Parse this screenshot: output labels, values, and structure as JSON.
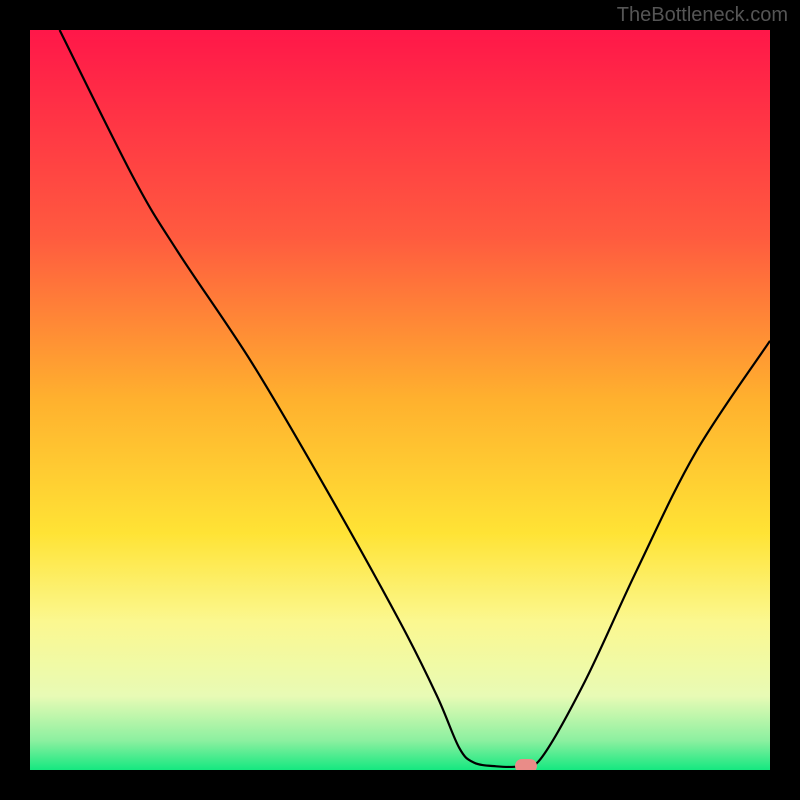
{
  "watermark": "TheBottleneck.com",
  "chart_data": {
    "type": "line",
    "title": "",
    "xlabel": "",
    "ylabel": "",
    "xlim": [
      0,
      100
    ],
    "ylim": [
      0,
      100
    ],
    "curve": [
      {
        "x": 4,
        "y": 100
      },
      {
        "x": 14,
        "y": 80
      },
      {
        "x": 20,
        "y": 70
      },
      {
        "x": 30,
        "y": 55
      },
      {
        "x": 40,
        "y": 38
      },
      {
        "x": 50,
        "y": 20
      },
      {
        "x": 55,
        "y": 10
      },
      {
        "x": 58,
        "y": 3
      },
      {
        "x": 60,
        "y": 1
      },
      {
        "x": 63,
        "y": 0.5
      },
      {
        "x": 66,
        "y": 0.5
      },
      {
        "x": 69,
        "y": 1.5
      },
      {
        "x": 75,
        "y": 12
      },
      {
        "x": 82,
        "y": 27
      },
      {
        "x": 90,
        "y": 43
      },
      {
        "x": 100,
        "y": 58
      }
    ],
    "marker": {
      "x": 67,
      "y": 0.5
    },
    "gradient_stops": [
      {
        "offset": 0,
        "color": "#ff1749"
      },
      {
        "offset": 28,
        "color": "#ff5b3f"
      },
      {
        "offset": 50,
        "color": "#ffb12e"
      },
      {
        "offset": 68,
        "color": "#ffe335"
      },
      {
        "offset": 80,
        "color": "#fbf890"
      },
      {
        "offset": 90,
        "color": "#e8fbb5"
      },
      {
        "offset": 96,
        "color": "#8cf0a0"
      },
      {
        "offset": 100,
        "color": "#15e880"
      }
    ]
  }
}
